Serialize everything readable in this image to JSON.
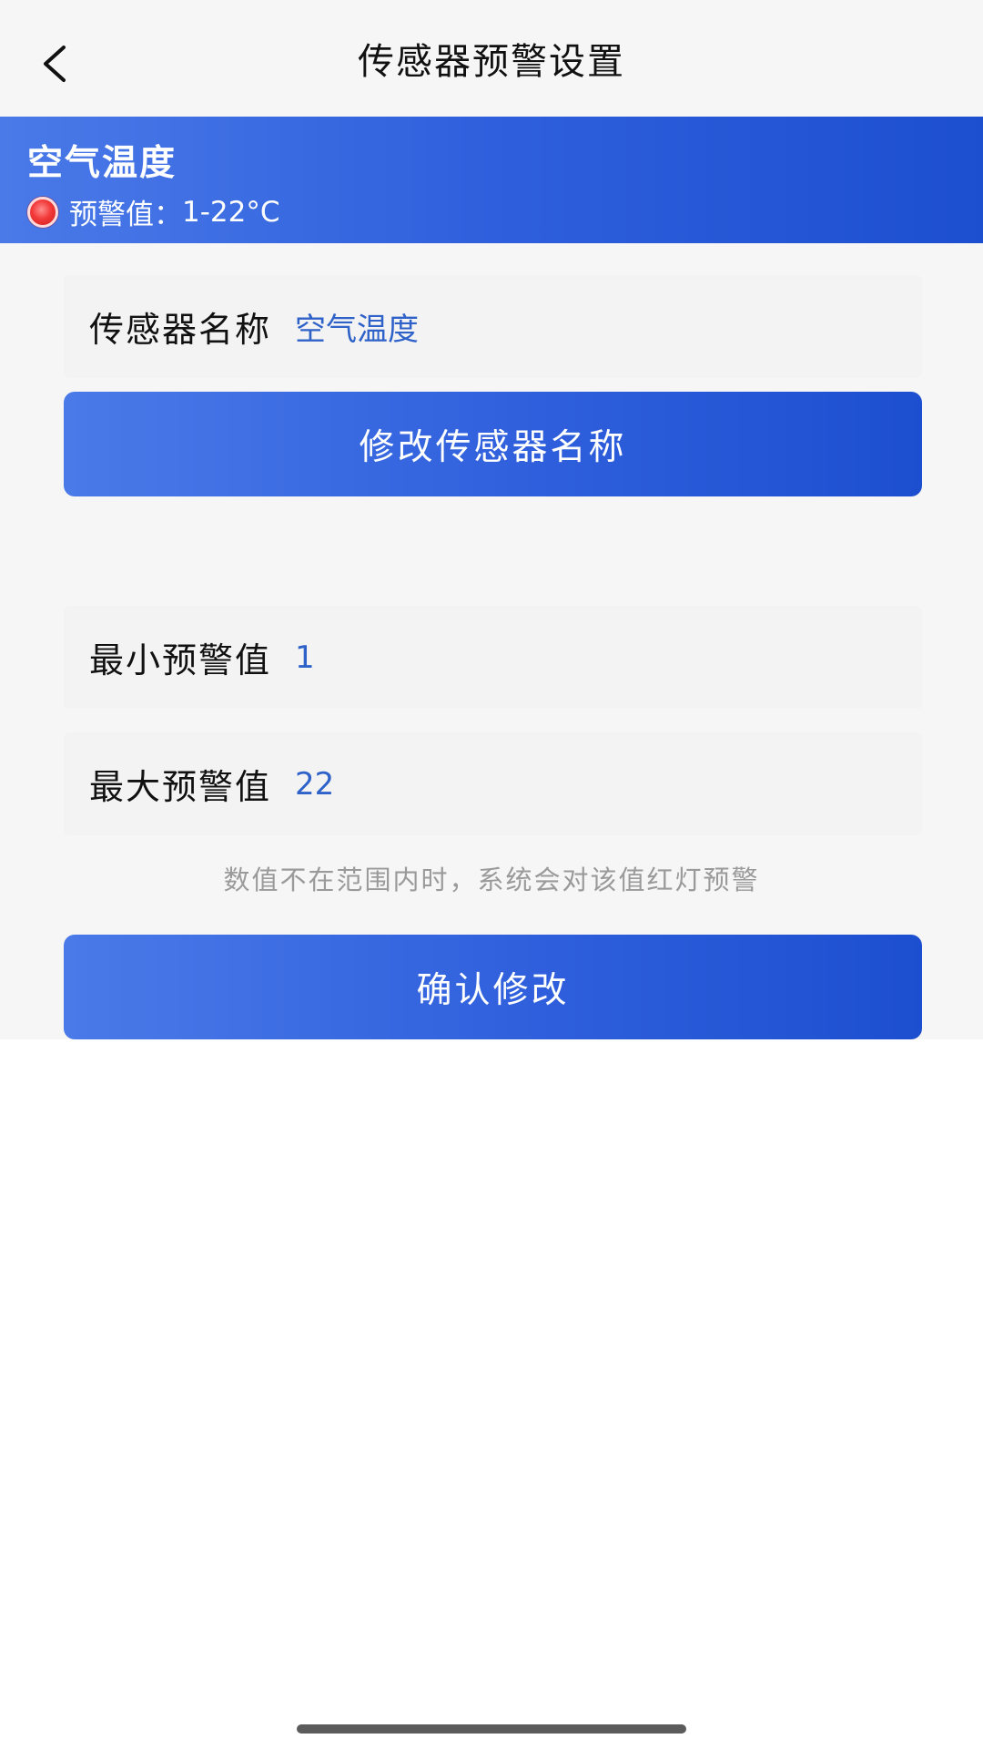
{
  "navbar": {
    "title": "传感器预警设置",
    "back_icon": "chevron-left-icon"
  },
  "banner": {
    "sensor_title": "空气温度",
    "alert_label": "预警值：",
    "alert_range": "1-22°C",
    "indicator_icon": "red-light-icon"
  },
  "form": {
    "name_label": "传感器名称",
    "name_value": "空气温度",
    "rename_button": "修改传感器名称",
    "min_label": "最小预警值",
    "min_value": "1",
    "max_label": "最大预警值",
    "max_value": "22",
    "hint": "数值不在范围内时，系统会对该值红灯预警",
    "confirm_button": "确认修改"
  },
  "colors": {
    "accent": "#2f5fdc",
    "value_text": "#2e62c9",
    "alert_red": "#f23a3a"
  }
}
